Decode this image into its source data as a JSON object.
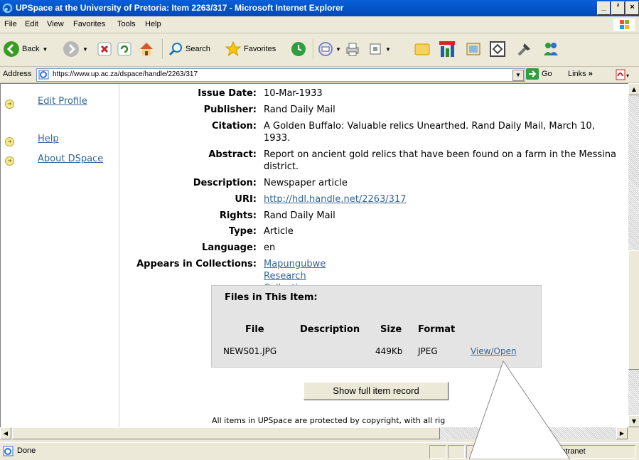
{
  "window": {
    "title": "UPSpace at the University of Pretoria: Item 2263/317 - Microsoft Internet Explorer",
    "min_label": "_",
    "max_label": "²",
    "close_label": "×"
  },
  "menu": {
    "items": [
      "File",
      "Edit",
      "View",
      "Favorites",
      "Tools",
      "Help"
    ]
  },
  "toolbar": {
    "back_label": "Back",
    "search_label": "Search",
    "favorites_label": "Favorites"
  },
  "address": {
    "label": "Address",
    "url": "https://www.up.ac.za/dspace/handle/2263/317",
    "go_label": "Go",
    "links_label": "Links"
  },
  "sidebar": {
    "items": [
      {
        "label": "Edit Profile"
      },
      {
        "label": "Help"
      },
      {
        "label": "About DSpace"
      }
    ]
  },
  "metadata": {
    "rows": [
      {
        "label": "Issue Date:",
        "value": "10-Mar-1933"
      },
      {
        "label": "Publisher:",
        "value": "Rand Daily Mail"
      },
      {
        "label": "Citation:",
        "value": "A Golden Buffalo: Valuable relics Unearthed. Rand Daily Mail, March 10, 1933."
      },
      {
        "label": "Abstract:",
        "value": "Report on ancient gold relics that have been found on a farm in the Messina district."
      },
      {
        "label": "Description:",
        "value": "Newspaper article"
      },
      {
        "label": "URI:",
        "value": "http://hdl.handle.net/2263/317"
      },
      {
        "label": "Rights:",
        "value": "Rand Daily Mail"
      },
      {
        "label": "Type:",
        "value": "Article"
      },
      {
        "label": "Language:",
        "value": "en"
      },
      {
        "label": "Appears in Collections:",
        "value": "Mapungubwe Research Collection"
      }
    ]
  },
  "files": {
    "heading": "Files in This Item:",
    "columns": [
      "File",
      "Description",
      "Size",
      "Format"
    ],
    "rows": [
      {
        "file": "NEWS01.JPG",
        "description": "",
        "size": "449Kb",
        "format": "JPEG",
        "action": "View/Open"
      }
    ]
  },
  "show_full_label": "Show full item record",
  "footer_text": "All items in UPSpace are protected by copyright, with all rig",
  "status": {
    "text": "Done",
    "zone": "intranet"
  }
}
